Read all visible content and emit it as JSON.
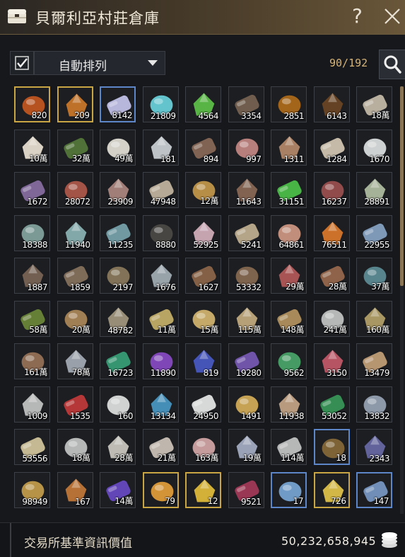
{
  "window": {
    "title": "貝爾利亞村莊倉庫",
    "help_label": "?"
  },
  "toolbar": {
    "sort_label": "自動排列",
    "sort_checked": true,
    "capacity": "90/192"
  },
  "footer": {
    "label": "交易所基準資訊價值",
    "value": "50,232,658,945"
  },
  "colors": {
    "title_gold": "#6a573a",
    "count_text": "#d6b478",
    "gold_frame": "#c9a544",
    "blue_frame": "#5c86c8"
  },
  "items": [
    [
      "820",
      "209",
      "8142",
      "21809",
      "4564",
      "3354",
      "2851",
      "6143",
      "18萬"
    ],
    [
      "10萬",
      "32萬",
      "49萬",
      "181",
      "894",
      "997",
      "1311",
      "1284",
      "1670"
    ],
    [
      "1672",
      "28072",
      "23909",
      "47948",
      "12萬",
      "11643",
      "31151",
      "16237",
      "28891"
    ],
    [
      "18388",
      "11940",
      "11235",
      "8880",
      "52925",
      "5241",
      "64861",
      "76511",
      "22955"
    ],
    [
      "1887",
      "1859",
      "2197",
      "1676",
      "1627",
      "53332",
      "29萬",
      "28萬",
      "37萬"
    ],
    [
      "58萬",
      "20萬",
      "48782",
      "11萬",
      "15萬",
      "115萬",
      "148萬",
      "241萬",
      "160萬"
    ],
    [
      "161萬",
      "78萬",
      "16723",
      "11890",
      "819",
      "19280",
      "9562",
      "3150",
      "13479"
    ],
    [
      "1009",
      "1535",
      "160",
      "13134",
      "24950",
      "1491",
      "11938",
      "53052",
      "13832"
    ],
    [
      "53556",
      "18萬",
      "28萬",
      "21萬",
      "163萬",
      "19萬",
      "114萬",
      "18",
      "2343"
    ],
    [
      "98949",
      "167",
      "14萬",
      "79",
      "12",
      "9521",
      "17",
      "726",
      "147"
    ]
  ]
}
